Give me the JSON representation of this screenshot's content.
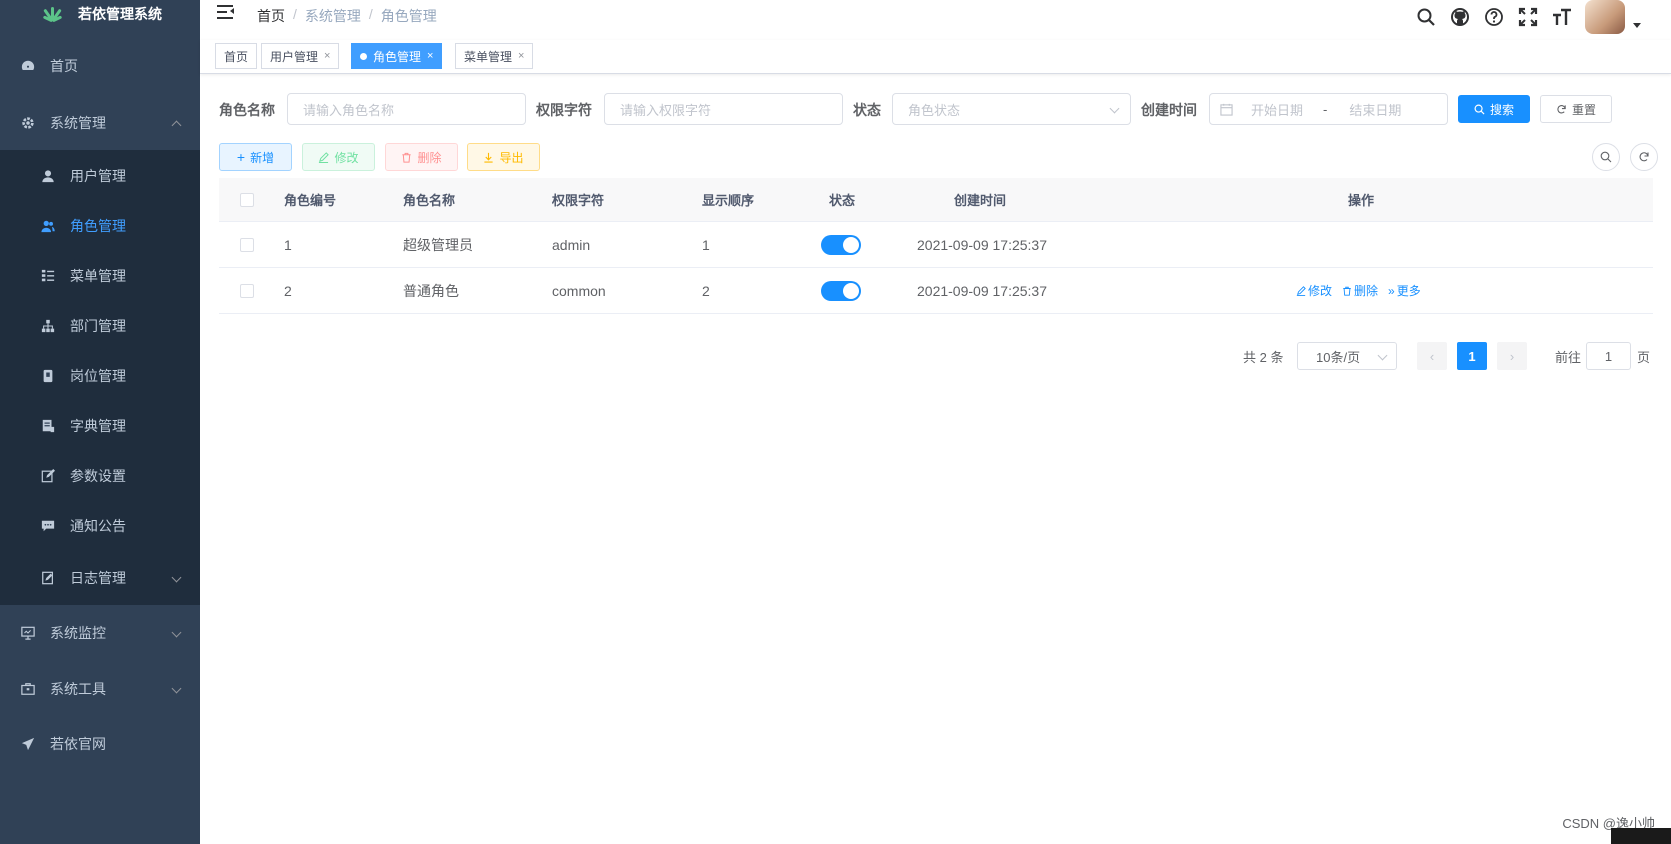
{
  "app": {
    "logo_text": "若依管理系统"
  },
  "sidebar": {
    "items": [
      {
        "label": "首页",
        "icon": "dashboard-icon"
      },
      {
        "label": "系统管理",
        "icon": "gear-icon"
      },
      {
        "label": "用户管理",
        "icon": "user-icon"
      },
      {
        "label": "角色管理",
        "icon": "peoples-icon"
      },
      {
        "label": "菜单管理",
        "icon": "tree-table-icon"
      },
      {
        "label": "部门管理",
        "icon": "tree-icon"
      },
      {
        "label": "岗位管理",
        "icon": "post-icon"
      },
      {
        "label": "字典管理",
        "icon": "dict-icon"
      },
      {
        "label": "参数设置",
        "icon": "edit-icon"
      },
      {
        "label": "通知公告",
        "icon": "message-icon"
      },
      {
        "label": "日志管理",
        "icon": "log-icon"
      },
      {
        "label": "系统监控",
        "icon": "monitor-icon"
      },
      {
        "label": "系统工具",
        "icon": "tool-icon"
      },
      {
        "label": "若依官网",
        "icon": "guide-icon"
      }
    ]
  },
  "breadcrumb": {
    "items": [
      "首页",
      "系统管理",
      "角色管理"
    ],
    "separator": "/"
  },
  "tags": [
    "首页",
    "用户管理",
    "角色管理",
    "菜单管理"
  ],
  "search": {
    "role_name_label": "角色名称",
    "role_name_placeholder": "请输入角色名称",
    "role_key_label": "权限字符",
    "role_key_placeholder": "请输入权限字符",
    "status_label": "状态",
    "status_placeholder": "角色状态",
    "create_time_label": "创建时间",
    "start_placeholder": "开始日期",
    "range_sep": "-",
    "end_placeholder": "结束日期",
    "search_button": "搜索",
    "reset_button": "重置"
  },
  "toolbar": {
    "add": "新增",
    "edit": "修改",
    "delete": "删除",
    "export": "导出"
  },
  "table": {
    "headers": [
      "角色编号",
      "角色名称",
      "权限字符",
      "显示顺序",
      "状态",
      "创建时间",
      "操作"
    ],
    "rows": [
      {
        "id": "1",
        "name": "超级管理员",
        "key": "admin",
        "sort": "1",
        "status_on": true,
        "create_time": "2021-09-09 17:25:37",
        "actions": []
      },
      {
        "id": "2",
        "name": "普通角色",
        "key": "common",
        "sort": "2",
        "status_on": true,
        "create_time": "2021-09-09 17:25:37",
        "actions": [
          "修改",
          "删除",
          "更多"
        ]
      }
    ]
  },
  "pagination": {
    "total_text": "共 2 条",
    "page_size": "10条/页",
    "current_page": "1",
    "goto_label": "前往",
    "goto_value": "1",
    "page_suffix": "页"
  },
  "watermark": "CSDN @逸小帅",
  "colors": {
    "sidebar_bg": "#304156",
    "submenu_bg": "#1f2d3d",
    "primary": "#1890ff",
    "active_text": "#409eff"
  }
}
